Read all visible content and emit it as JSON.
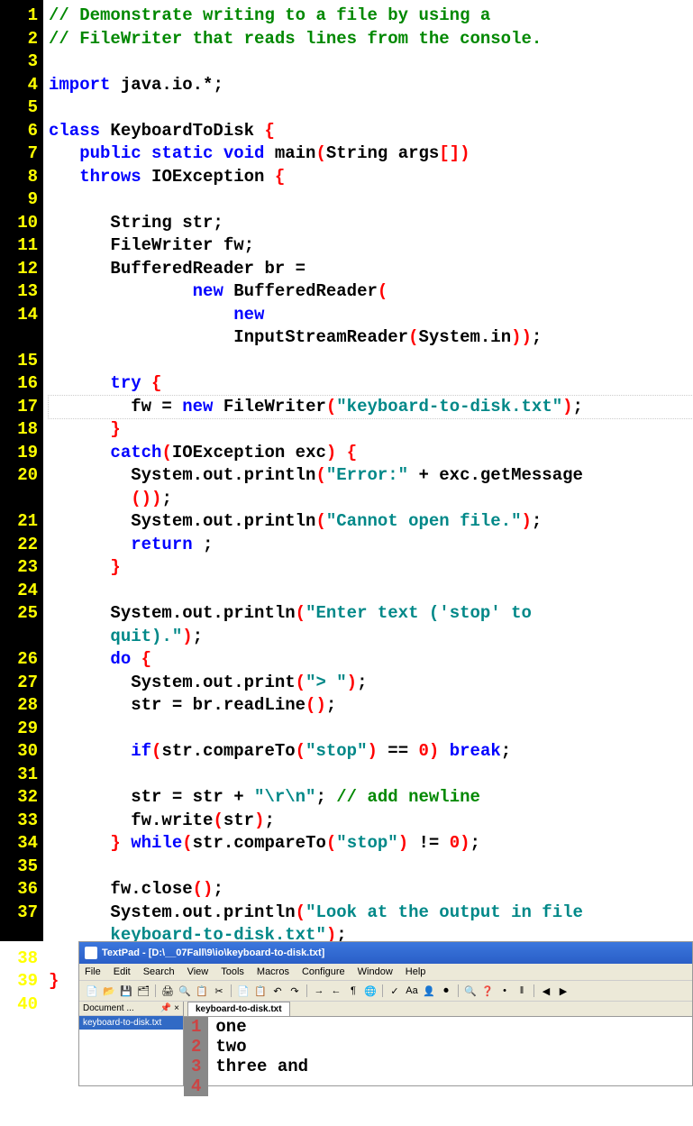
{
  "lines": [
    {
      "n": "1",
      "t": [
        {
          "c": "com",
          "s": "// Demonstrate writing to a file by using a"
        }
      ]
    },
    {
      "n": "2",
      "t": [
        {
          "c": "com",
          "s": "// FileWriter that reads lines from the console."
        }
      ]
    },
    {
      "n": "3",
      "t": []
    },
    {
      "n": "4",
      "t": [
        {
          "c": "kw",
          "s": "import"
        },
        {
          "c": "id",
          "s": " java.io.*;"
        }
      ]
    },
    {
      "n": "5",
      "t": []
    },
    {
      "n": "6",
      "t": [
        {
          "c": "kw",
          "s": "class"
        },
        {
          "c": "id",
          "s": " KeyboardToDisk "
        },
        {
          "c": "br",
          "s": "{"
        }
      ]
    },
    {
      "n": "7",
      "t": [
        {
          "c": "id",
          "s": "   "
        },
        {
          "c": "kw",
          "s": "public static void"
        },
        {
          "c": "id",
          "s": " main"
        },
        {
          "c": "br",
          "s": "("
        },
        {
          "c": "id",
          "s": "String args"
        },
        {
          "c": "br",
          "s": "[])"
        }
      ]
    },
    {
      "n": "8",
      "t": [
        {
          "c": "id",
          "s": "   "
        },
        {
          "c": "kw",
          "s": "throws"
        },
        {
          "c": "id",
          "s": " IOException "
        },
        {
          "c": "br",
          "s": "{"
        }
      ]
    },
    {
      "n": "9",
      "t": []
    },
    {
      "n": "10",
      "t": [
        {
          "c": "id",
          "s": "      String str;"
        }
      ]
    },
    {
      "n": "11",
      "t": [
        {
          "c": "id",
          "s": "      FileWriter fw;"
        }
      ]
    },
    {
      "n": "12",
      "t": [
        {
          "c": "id",
          "s": "      BufferedReader br ="
        }
      ]
    },
    {
      "n": "13",
      "t": [
        {
          "c": "id",
          "s": "              "
        },
        {
          "c": "kw",
          "s": "new"
        },
        {
          "c": "id",
          "s": " BufferedReader"
        },
        {
          "c": "br",
          "s": "("
        }
      ]
    },
    {
      "n": "14",
      "t": [
        {
          "c": "id",
          "s": "                  "
        },
        {
          "c": "kw",
          "s": "new"
        },
        {
          "c": "id",
          "s": "\n                  InputStreamReader"
        },
        {
          "c": "br",
          "s": "("
        },
        {
          "c": "id",
          "s": "System.in"
        },
        {
          "c": "br",
          "s": "))"
        },
        {
          "c": "id",
          "s": ";"
        }
      ]
    },
    {
      "n": "15",
      "t": []
    },
    {
      "n": "16",
      "t": [
        {
          "c": "id",
          "s": "      "
        },
        {
          "c": "kw",
          "s": "try"
        },
        {
          "c": "id",
          "s": " "
        },
        {
          "c": "br",
          "s": "{"
        }
      ]
    },
    {
      "n": "17",
      "hl": true,
      "t": [
        {
          "c": "id",
          "s": "        fw = "
        },
        {
          "c": "kw",
          "s": "new"
        },
        {
          "c": "id",
          "s": " FileWriter"
        },
        {
          "c": "br",
          "s": "("
        },
        {
          "c": "str",
          "s": "\"keyboard-to-disk.txt\""
        },
        {
          "c": "br",
          "s": ")"
        },
        {
          "c": "id",
          "s": ";"
        }
      ]
    },
    {
      "n": "18",
      "t": [
        {
          "c": "id",
          "s": "      "
        },
        {
          "c": "br",
          "s": "}"
        }
      ]
    },
    {
      "n": "19",
      "t": [
        {
          "c": "id",
          "s": "      "
        },
        {
          "c": "kw",
          "s": "catch"
        },
        {
          "c": "br",
          "s": "("
        },
        {
          "c": "id",
          "s": "IOException exc"
        },
        {
          "c": "br",
          "s": ")"
        },
        {
          "c": "id",
          "s": " "
        },
        {
          "c": "br",
          "s": "{"
        }
      ]
    },
    {
      "n": "20",
      "t": [
        {
          "c": "id",
          "s": "        System.out.println"
        },
        {
          "c": "br",
          "s": "("
        },
        {
          "c": "str",
          "s": "\"Error:\""
        },
        {
          "c": "id",
          "s": " + exc.getMessage\n        "
        },
        {
          "c": "br",
          "s": "())"
        },
        {
          "c": "id",
          "s": ";"
        }
      ]
    },
    {
      "n": "21",
      "t": [
        {
          "c": "id",
          "s": "        System.out.println"
        },
        {
          "c": "br",
          "s": "("
        },
        {
          "c": "str",
          "s": "\"Cannot open file.\""
        },
        {
          "c": "br",
          "s": ")"
        },
        {
          "c": "id",
          "s": ";"
        }
      ]
    },
    {
      "n": "22",
      "t": [
        {
          "c": "id",
          "s": "        "
        },
        {
          "c": "kw",
          "s": "return"
        },
        {
          "c": "id",
          "s": " ;"
        }
      ]
    },
    {
      "n": "23",
      "t": [
        {
          "c": "id",
          "s": "      "
        },
        {
          "c": "br",
          "s": "}"
        }
      ]
    },
    {
      "n": "24",
      "t": []
    },
    {
      "n": "25",
      "t": [
        {
          "c": "id",
          "s": "      System.out.println"
        },
        {
          "c": "br",
          "s": "("
        },
        {
          "c": "str",
          "s": "\"Enter text ('stop' to \n      quit).\""
        },
        {
          "c": "br",
          "s": ")"
        },
        {
          "c": "id",
          "s": ";"
        }
      ]
    },
    {
      "n": "26",
      "t": [
        {
          "c": "id",
          "s": "      "
        },
        {
          "c": "kw",
          "s": "do"
        },
        {
          "c": "id",
          "s": " "
        },
        {
          "c": "br",
          "s": "{"
        }
      ]
    },
    {
      "n": "27",
      "t": [
        {
          "c": "id",
          "s": "        System.out.print"
        },
        {
          "c": "br",
          "s": "("
        },
        {
          "c": "str",
          "s": "\"> \""
        },
        {
          "c": "br",
          "s": ")"
        },
        {
          "c": "id",
          "s": ";"
        }
      ]
    },
    {
      "n": "28",
      "t": [
        {
          "c": "id",
          "s": "        str = br.readLine"
        },
        {
          "c": "br",
          "s": "()"
        },
        {
          "c": "id",
          "s": ";"
        }
      ]
    },
    {
      "n": "29",
      "t": []
    },
    {
      "n": "30",
      "t": [
        {
          "c": "id",
          "s": "        "
        },
        {
          "c": "kw",
          "s": "if"
        },
        {
          "c": "br",
          "s": "("
        },
        {
          "c": "id",
          "s": "str.compareTo"
        },
        {
          "c": "br",
          "s": "("
        },
        {
          "c": "str",
          "s": "\"stop\""
        },
        {
          "c": "br",
          "s": ")"
        },
        {
          "c": "id",
          "s": " == "
        },
        {
          "c": "num",
          "s": "0"
        },
        {
          "c": "br",
          "s": ")"
        },
        {
          "c": "id",
          "s": " "
        },
        {
          "c": "kw",
          "s": "break"
        },
        {
          "c": "id",
          "s": ";"
        }
      ]
    },
    {
      "n": "31",
      "t": []
    },
    {
      "n": "32",
      "t": [
        {
          "c": "id",
          "s": "        str = str + "
        },
        {
          "c": "str",
          "s": "\"\\r\\n\""
        },
        {
          "c": "id",
          "s": "; "
        },
        {
          "c": "com",
          "s": "// add newline"
        }
      ]
    },
    {
      "n": "33",
      "t": [
        {
          "c": "id",
          "s": "        fw.write"
        },
        {
          "c": "br",
          "s": "("
        },
        {
          "c": "id",
          "s": "str"
        },
        {
          "c": "br",
          "s": ")"
        },
        {
          "c": "id",
          "s": ";"
        }
      ]
    },
    {
      "n": "34",
      "t": [
        {
          "c": "id",
          "s": "      "
        },
        {
          "c": "br",
          "s": "}"
        },
        {
          "c": "id",
          "s": " "
        },
        {
          "c": "kw",
          "s": "while"
        },
        {
          "c": "br",
          "s": "("
        },
        {
          "c": "id",
          "s": "str.compareTo"
        },
        {
          "c": "br",
          "s": "("
        },
        {
          "c": "str",
          "s": "\"stop\""
        },
        {
          "c": "br",
          "s": ")"
        },
        {
          "c": "id",
          "s": " != "
        },
        {
          "c": "num",
          "s": "0"
        },
        {
          "c": "br",
          "s": ")"
        },
        {
          "c": "id",
          "s": ";"
        }
      ]
    },
    {
      "n": "35",
      "t": []
    },
    {
      "n": "36",
      "t": [
        {
          "c": "id",
          "s": "      fw.close"
        },
        {
          "c": "br",
          "s": "()"
        },
        {
          "c": "id",
          "s": ";"
        }
      ]
    },
    {
      "n": "37",
      "t": [
        {
          "c": "id",
          "s": "      System.out.println"
        },
        {
          "c": "br",
          "s": "("
        },
        {
          "c": "str",
          "s": "\"Look at the output in file \n      keyboard-to-disk.txt\""
        },
        {
          "c": "br",
          "s": ")"
        },
        {
          "c": "id",
          "s": ";"
        }
      ]
    },
    {
      "n": "38",
      "t": [
        {
          "c": "id",
          "s": "   "
        },
        {
          "c": "br",
          "s": "}"
        }
      ]
    },
    {
      "n": "39",
      "t": [
        {
          "c": "br",
          "s": "}"
        }
      ]
    },
    {
      "n": "40",
      "t": []
    }
  ],
  "textpad": {
    "title": "TextPad - [D:\\__07Fall\\9\\io\\keyboard-to-disk.txt]",
    "menus": [
      "File",
      "Edit",
      "Search",
      "View",
      "Tools",
      "Macros",
      "Configure",
      "Window",
      "Help"
    ],
    "docPanel": {
      "header": "Document ... ",
      "pin": "📌",
      "close": "×",
      "item": "keyboard-to-disk.txt"
    },
    "tab": "keyboard-to-disk.txt",
    "content": [
      {
        "n": "1",
        "t": "one"
      },
      {
        "n": "2",
        "t": "two"
      },
      {
        "n": "3",
        "t": "three  and"
      },
      {
        "n": "4",
        "t": ""
      }
    ],
    "toolbar_icons": [
      "new",
      "open",
      "save",
      "saveall",
      "print",
      "preview",
      "printscreen",
      "cut",
      "copy",
      "paste",
      "undo",
      "redo",
      "indent",
      "outdent",
      "paragraph",
      "web",
      "spell",
      "find",
      "run",
      "record",
      "zoom",
      "help",
      "dot",
      "pipe",
      "playL",
      "playR"
    ]
  }
}
